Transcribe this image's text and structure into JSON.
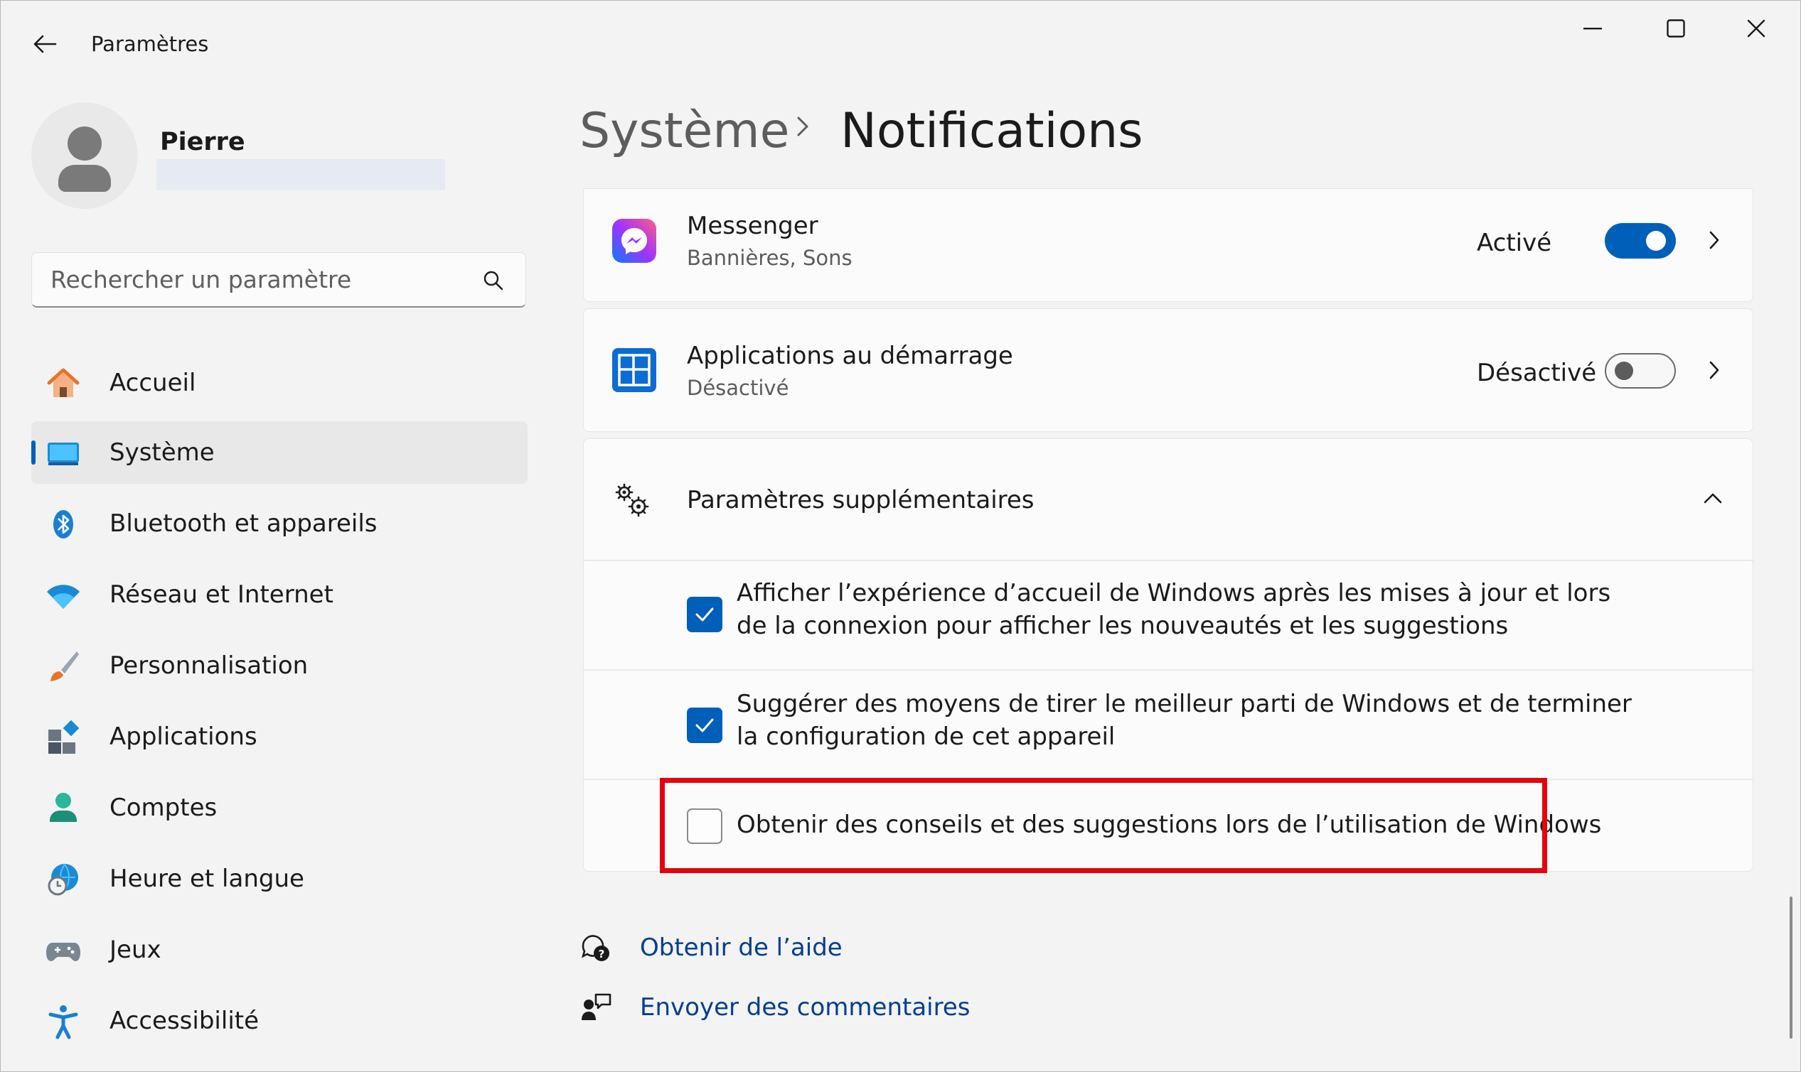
{
  "window": {
    "title": "Paramètres"
  },
  "user": {
    "name": "Pierre"
  },
  "search": {
    "placeholder": "Rechercher un paramètre"
  },
  "sidebar": {
    "items": [
      {
        "label": "Accueil",
        "icon": "home-icon"
      },
      {
        "label": "Système",
        "icon": "system-icon",
        "selected": true
      },
      {
        "label": "Bluetooth et appareils",
        "icon": "bluetooth-icon"
      },
      {
        "label": "Réseau et Internet",
        "icon": "wifi-icon"
      },
      {
        "label": "Personnalisation",
        "icon": "brush-icon"
      },
      {
        "label": "Applications",
        "icon": "apps-icon"
      },
      {
        "label": "Comptes",
        "icon": "account-icon"
      },
      {
        "label": "Heure et langue",
        "icon": "time-language-icon"
      },
      {
        "label": "Jeux",
        "icon": "gamepad-icon"
      },
      {
        "label": "Accessibilité",
        "icon": "accessibility-icon"
      }
    ]
  },
  "breadcrumb": {
    "parent": "Système",
    "separator": "›",
    "current": "Notifications"
  },
  "apps": [
    {
      "name": "Messenger",
      "subtitle": "Bannières, Sons",
      "state": "Activé",
      "enabled": true,
      "icon": "messenger-icon"
    },
    {
      "name": "Applications au démarrage",
      "subtitle": "Désactivé",
      "state": "Désactivé",
      "enabled": false,
      "icon": "startup-apps-icon"
    }
  ],
  "additional": {
    "title": "Paramètres supplémentaires",
    "expanded": true,
    "options": [
      {
        "text": "Afficher l’expérience d’accueil de Windows après les mises à jour et lors de la connexion pour afficher les nouveautés et les suggestions",
        "checked": true
      },
      {
        "text": "Suggérer des moyens de tirer le meilleur parti de Windows et de terminer la configuration de cet appareil",
        "checked": true
      },
      {
        "text": "Obtenir des conseils et des suggestions lors de l’utilisation de Windows",
        "checked": false
      }
    ]
  },
  "footer": {
    "help": "Obtenir de l’aide",
    "feedback": "Envoyer des commentaires"
  },
  "colors": {
    "accent": "#005fb8",
    "highlight": "#e8000b",
    "link": "#003e92"
  }
}
